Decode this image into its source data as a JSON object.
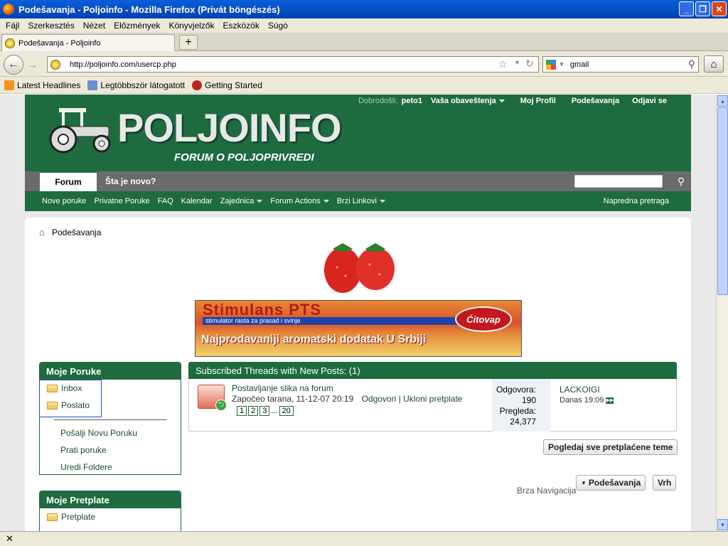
{
  "window": {
    "title": "Podešavanja - Poljoinfo - Mozilla Firefox (Privát böngészés)"
  },
  "menu": [
    "Fájl",
    "Szerkesztés",
    "Nézet",
    "Előzmények",
    "Könyvjelzők",
    "Eszközök",
    "Súgó"
  ],
  "tab": {
    "label": "Podešavanja - Poljoinfo"
  },
  "url": "http://poljoinfo.com/usercp.php",
  "search_value": "gmail",
  "bookmarks": [
    "Latest Headlines",
    "Legtöbbször látogatott",
    "Getting Started"
  ],
  "header": {
    "logo_text": "POLJOINFO",
    "logo_sub": "FORUM O POLJOPRIVREDI",
    "welcome": "Dobrodošli,",
    "username": "peto1",
    "notifications": "Vaša obaveštenja",
    "profile": "Moj Profil",
    "settings": "Podešavanja",
    "logout": "Odjavi se"
  },
  "tabs": {
    "forum": "Forum",
    "new": "Šta je novo?"
  },
  "subnav": {
    "items": [
      "Nove poruke",
      "Privatne Poruke",
      "FAQ",
      "Kalendar",
      "Zajednica",
      "Forum Actions",
      "Brzi Linkovi"
    ],
    "advanced_search": "Napredna pretraga"
  },
  "breadcrumb": "Podešavanja",
  "banner": {
    "title": "Stimulans PTS",
    "subtitle": "stimulator rasta za prasad i svinje",
    "brand": "Ćitovap",
    "slogan": "Najprodavaniji aromatski dodatak U Srbiji"
  },
  "sidebar": {
    "messages_title": "Moje Poruke",
    "folders": [
      "Inbox",
      "Poslato"
    ],
    "links": [
      "Pošalji Novu Poruku",
      "Prati poruke",
      "Uredi Foldere"
    ],
    "subs_title": "Moje Pretplate",
    "subs_folder": "Pretplate"
  },
  "subscribed": {
    "heading": "Subscribed Threads with New Posts: (1)",
    "thread_title": "Postavljanje slika na forum",
    "started_by": "Započeo tarana, 11-12-07 20:19",
    "replies_link": "Odgovori",
    "separator": "|",
    "unsubscribe_link": "Ukloni pretplate",
    "pages": [
      "1",
      "2",
      "3",
      "...",
      "20"
    ],
    "replies_label": "Odgovora:",
    "replies_count": "190",
    "views_label": "Pregleda:",
    "views_count": "24,377",
    "last_poster": "LACKOIGI",
    "last_time": "Danas 19:09"
  },
  "buttons": {
    "view_all": "Pogledaj sve pretplaćene teme",
    "quick_nav_label": "Brza Navigacija",
    "quick_nav_button": "Podešavanja",
    "top": "Vrh"
  },
  "statusbar_close": "✕"
}
